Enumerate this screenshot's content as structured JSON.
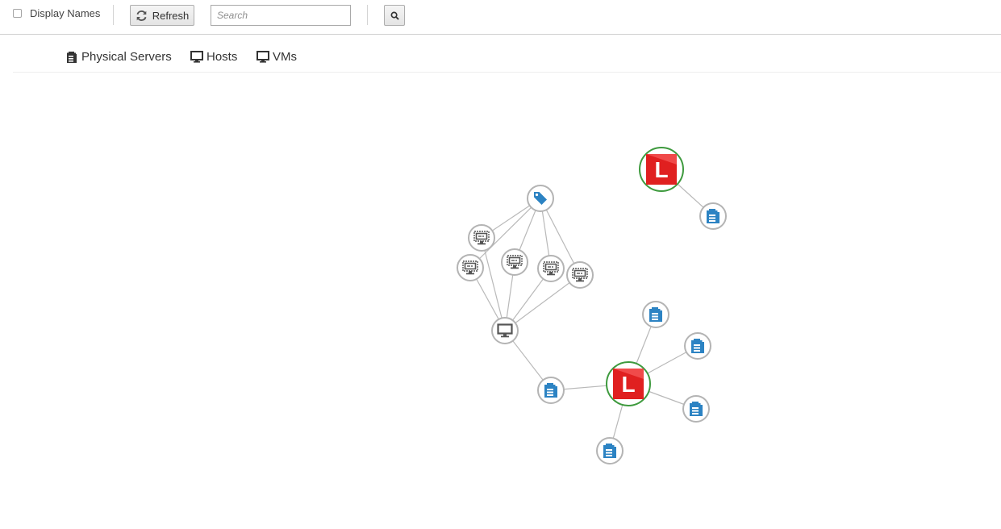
{
  "toolbar": {
    "display_names_label": "Display Names",
    "display_names_checked": false,
    "refresh_label": "Refresh",
    "search_placeholder": "Search",
    "search_value": ""
  },
  "legend": {
    "items": [
      {
        "label": "Physical Servers",
        "icon": "server-icon"
      },
      {
        "label": "Hosts",
        "icon": "monitor-icon"
      },
      {
        "label": "VMs",
        "icon": "monitor-icon"
      }
    ]
  },
  "graph": {
    "provider_letter": "L",
    "colors": {
      "provider_ring": "#3e9a3e",
      "provider_fill": "#e02020",
      "server_blue": "#2c83c3",
      "node_ring": "#b4b4b4",
      "edge": "#b9b9b9",
      "icon_gray": "#555555"
    }
  }
}
